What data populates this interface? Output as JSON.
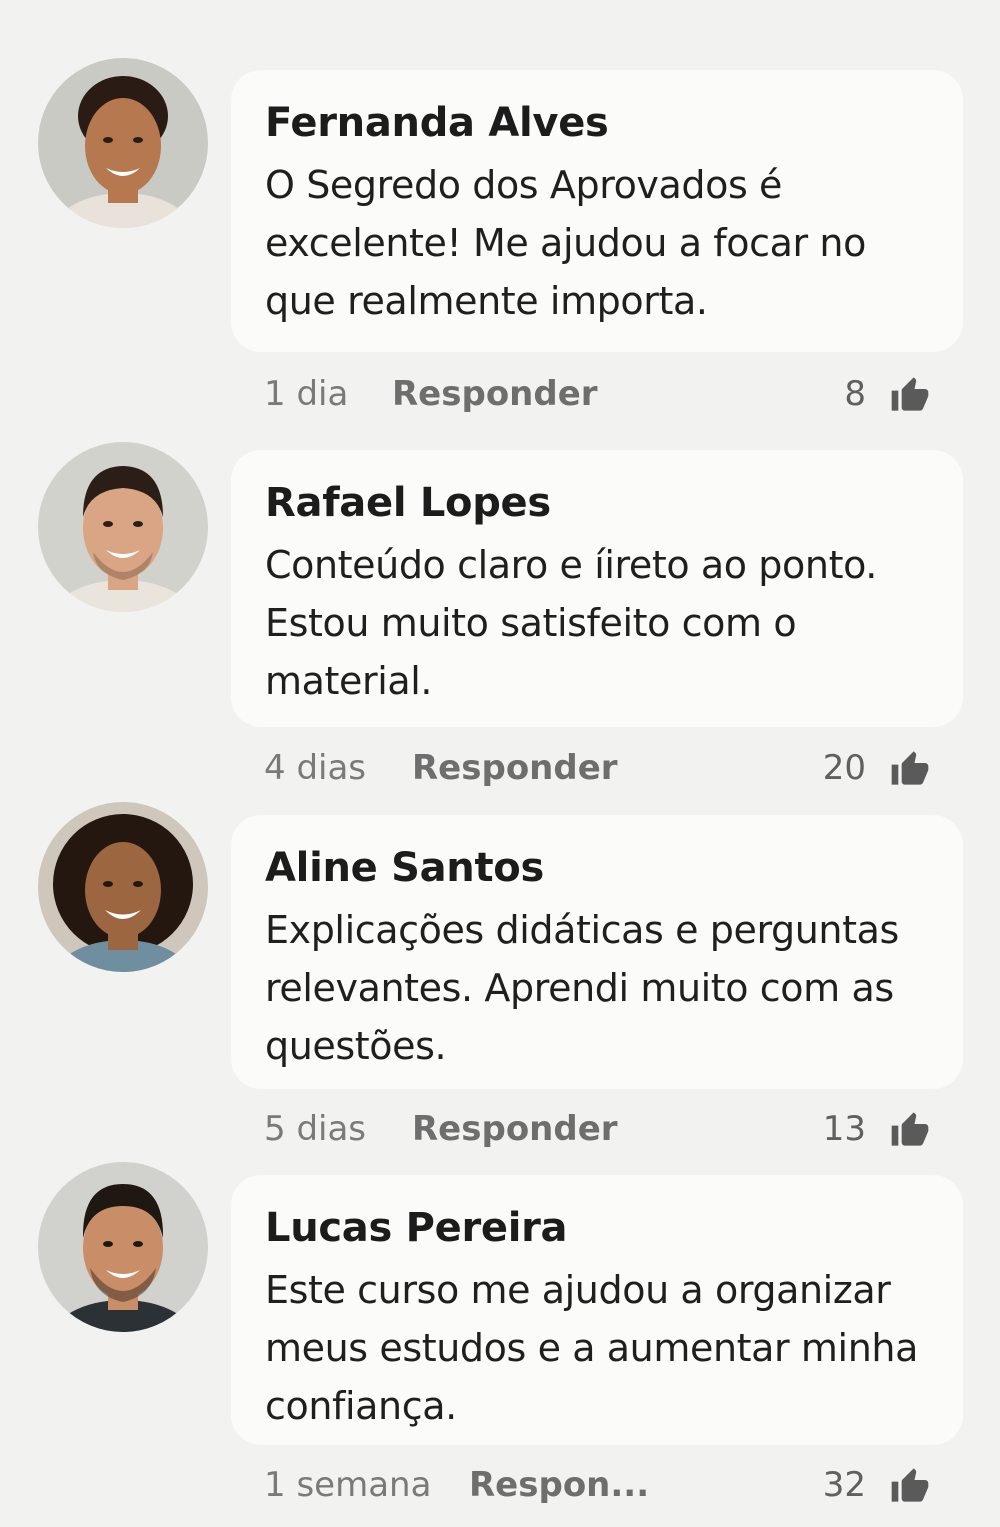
{
  "comments": [
    {
      "author": "Fernanda Alves",
      "text": "O Segredo dos Aprovados é excelente! Me ajudou a focar no que realmente importa.",
      "time": "1 dia",
      "reply": "Responder",
      "likes": "8",
      "avatar": {
        "skin": "#b5784f",
        "hair": "#2a1b14",
        "shirt": "#e8e2da",
        "bg": "#c9cac4"
      }
    },
    {
      "author": "Rafael Lopes",
      "text": "Conteúdo claro e íireto ao ponto. Estou muito satisfeito com o material.",
      "time": "4 dias",
      "reply": "Responder",
      "likes": "20",
      "avatar": {
        "skin": "#d9a584",
        "hair": "#2b1e17",
        "shirt": "#e9e4dc",
        "bg": "#d2d2cc"
      }
    },
    {
      "author": "Aline Santos",
      "text": "Explicações didáticas e perguntas relevantes. Aprendi muito com as questões.",
      "time": "5 dias",
      "reply": "Responder",
      "likes": "13",
      "avatar": {
        "skin": "#9c6640",
        "hair": "#231710",
        "shirt": "#6f8fa0",
        "bg": "#cfc7bc"
      }
    },
    {
      "author": "Lucas Pereira",
      "text": "Este curso me ajudou a organizar meus estudos e a aumentar minha confiança.",
      "time": "1 semana",
      "reply": "Respon...",
      "likes": "32",
      "avatar": {
        "skin": "#c98d68",
        "hair": "#1f1712",
        "shirt": "#2c3136",
        "bg": "#d1d1cd"
      }
    }
  ],
  "colors": {
    "background": "#f2f2f0",
    "bubble": "#fbfbfa",
    "meta_text": "#7a7a7a",
    "like_icon": "#5a5a5a"
  }
}
